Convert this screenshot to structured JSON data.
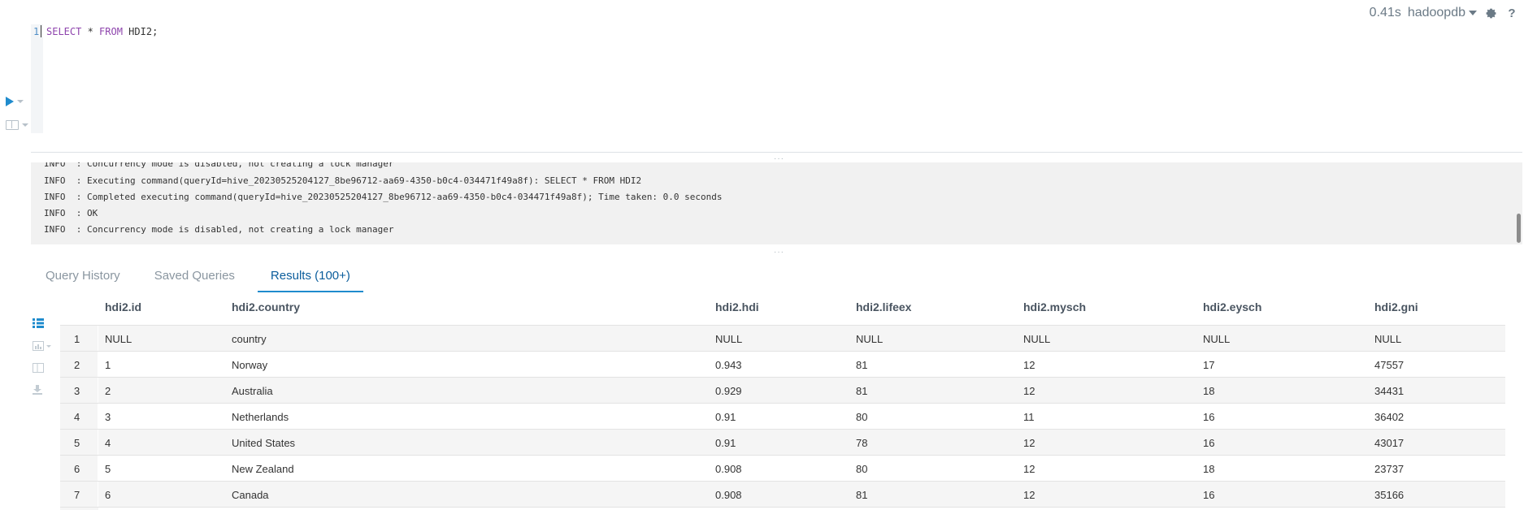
{
  "status": {
    "timing": "0.41s",
    "database": "hadoopdb",
    "settings_icon": "gear-icon",
    "help_icon": "question-icon",
    "help_label": "?"
  },
  "editor": {
    "line_number": "1",
    "query": {
      "kw1": "SELECT",
      "star": " * ",
      "kw2": "FROM",
      "rest": " HDI2;"
    }
  },
  "logs": [
    "INFO  : Concurrency mode is disabled, not creating a lock manager",
    "INFO  : Executing command(queryId=hive_20230525204127_8be96712-aa69-4350-b0c4-034471f49a8f): SELECT * FROM HDI2",
    "INFO  : Completed executing command(queryId=hive_20230525204127_8be96712-aa69-4350-b0c4-034471f49a8f); Time taken: 0.0 seconds",
    "INFO  : OK",
    "INFO  : Concurrency mode is disabled, not creating a lock manager"
  ],
  "tabs": [
    {
      "label": "Query History"
    },
    {
      "label": "Saved Queries"
    },
    {
      "label": "Results (100+)"
    }
  ],
  "table": {
    "columns": [
      "hdi2.id",
      "hdi2.country",
      "hdi2.hdi",
      "hdi2.lifeex",
      "hdi2.mysch",
      "hdi2.eysch",
      "hdi2.gni"
    ],
    "rows": [
      [
        "1",
        "NULL",
        "country",
        "NULL",
        "NULL",
        "NULL",
        "NULL",
        "NULL"
      ],
      [
        "2",
        "1",
        "Norway",
        "0.943",
        "81",
        "12",
        "17",
        "47557"
      ],
      [
        "3",
        "2",
        "Australia",
        "0.929",
        "81",
        "12",
        "18",
        "34431"
      ],
      [
        "4",
        "3",
        "Netherlands",
        "0.91",
        "80",
        "11",
        "16",
        "36402"
      ],
      [
        "5",
        "4",
        "United States",
        "0.91",
        "78",
        "12",
        "16",
        "43017"
      ],
      [
        "6",
        "5",
        "New Zealand",
        "0.908",
        "80",
        "12",
        "18",
        "23737"
      ],
      [
        "7",
        "6",
        "Canada",
        "0.908",
        "81",
        "12",
        "16",
        "35166"
      ]
    ]
  }
}
